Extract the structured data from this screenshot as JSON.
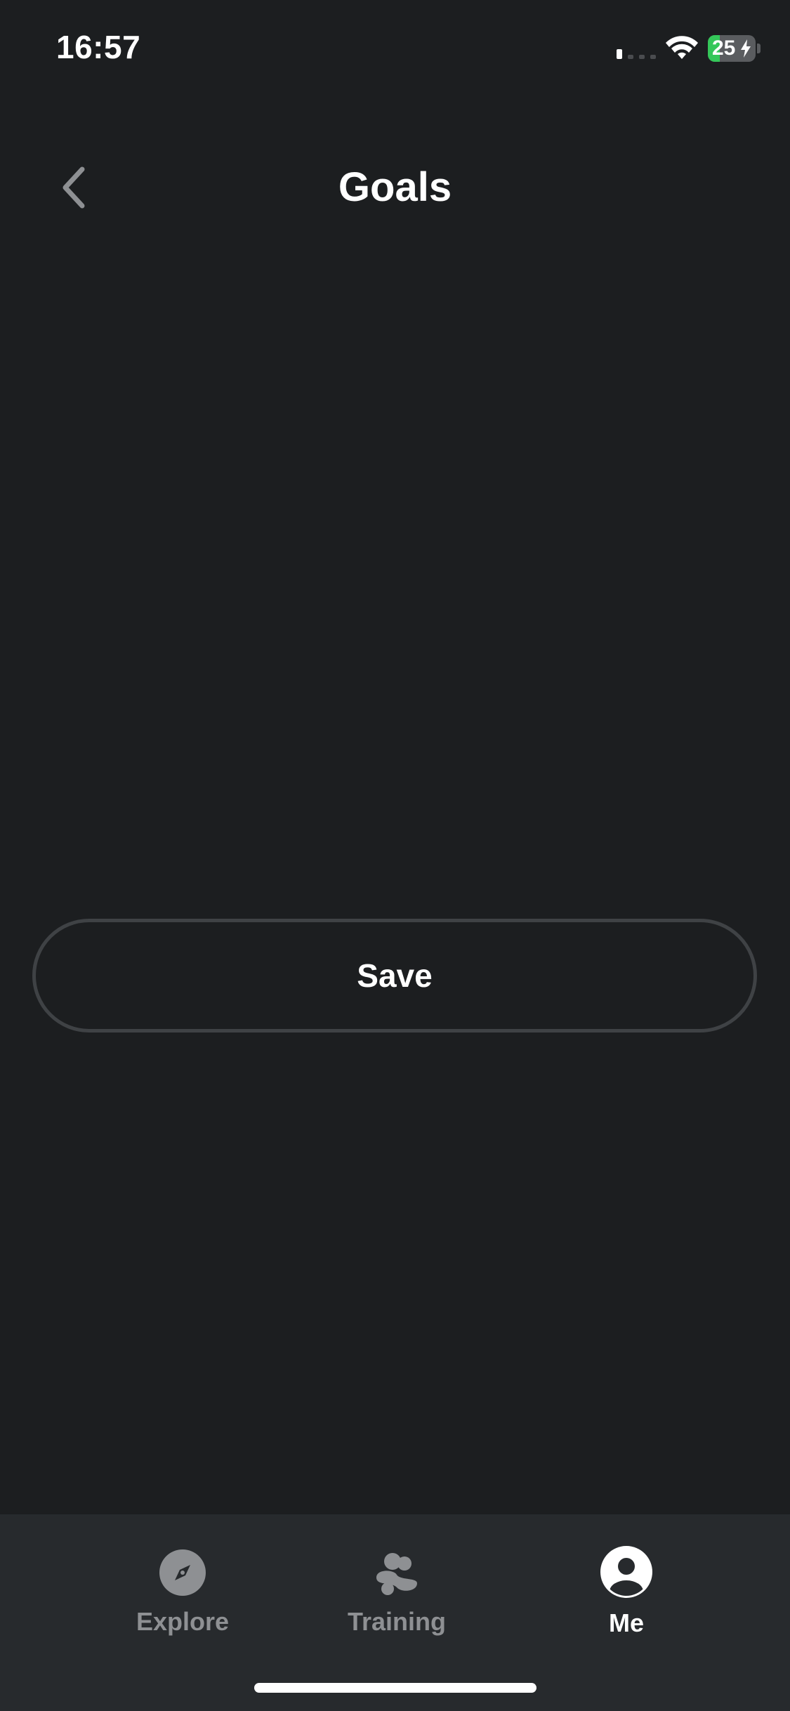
{
  "status_bar": {
    "time": "16:57",
    "battery_level": "25",
    "battery_fraction": 0.25,
    "signal_bars_active": 1,
    "signal_bars_total": 4,
    "charging": true
  },
  "header": {
    "title": "Goals",
    "back_icon": "chevron-left-icon"
  },
  "actions": {
    "save_label": "Save"
  },
  "tab_bar": {
    "tabs": [
      {
        "label": "Explore",
        "icon": "compass-icon",
        "active": false
      },
      {
        "label": "Training",
        "icon": "training-icon",
        "active": false
      },
      {
        "label": "Me",
        "icon": "profile-icon",
        "active": true
      }
    ]
  },
  "colors": {
    "background": "#1c1e20",
    "tab_bar_background": "#272a2d",
    "button_border": "#3f4245",
    "inactive_tab": "#8e9093",
    "active_tab": "#ffffff",
    "battery_green": "#34c759"
  }
}
